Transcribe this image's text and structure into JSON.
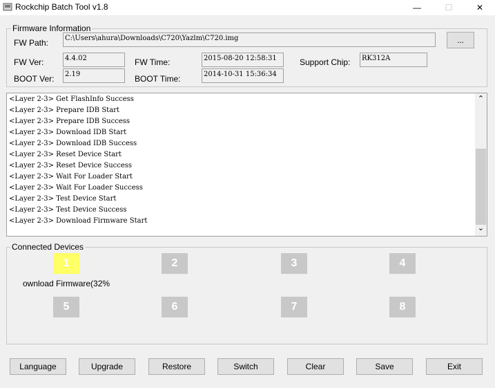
{
  "window": {
    "title": "Rockchip Batch Tool v1.8",
    "min_glyph": "—",
    "max_glyph": "☐",
    "close_glyph": "✕"
  },
  "firmware": {
    "legend": "Firmware Information",
    "fw_path_label": "FW Path:",
    "fw_path_value": "C:\\Users\\ahura\\Downloads\\C720\\Yazlm\\C720.img",
    "browse_label": "...",
    "fw_ver_label": "FW Ver:",
    "fw_ver_value": "4.4.02",
    "fw_time_label": "FW Time:",
    "fw_time_value": "2015-08-20 12:58:31",
    "support_chip_label": "Support Chip:",
    "support_chip_value": "RK312A",
    "boot_ver_label": "BOOT Ver:",
    "boot_ver_value": "2.19",
    "boot_time_label": "BOOT Time:",
    "boot_time_value": "2014-10-31 15:36:34"
  },
  "log": {
    "lines": [
      "<Layer 2-3> Get FlashInfo Success",
      "<Layer 2-3> Prepare IDB Start",
      "<Layer 2-3> Prepare IDB Success",
      "<Layer 2-3> Download IDB Start",
      "<Layer 2-3> Download IDB Success",
      "<Layer 2-3> Reset Device Start",
      "<Layer 2-3> Reset Device Success",
      "<Layer 2-3> Wait For Loader Start",
      "<Layer 2-3> Wait For Loader Success",
      "<Layer 2-3> Test Device Start",
      "<Layer 2-3> Test Device Success",
      "<Layer 2-3> Download Firmware Start"
    ],
    "scroll_up": "⌃",
    "scroll_down": "⌄"
  },
  "devices": {
    "legend": "Connected Devices",
    "slots": [
      "1",
      "2",
      "3",
      "4",
      "5",
      "6",
      "7",
      "8"
    ],
    "active_slot": "1",
    "status_text": "ownload Firmware(32%"
  },
  "buttons": {
    "language": "Language",
    "upgrade": "Upgrade",
    "restore": "Restore",
    "switch": "Switch",
    "clear": "Clear",
    "save": "Save",
    "exit": "Exit"
  }
}
